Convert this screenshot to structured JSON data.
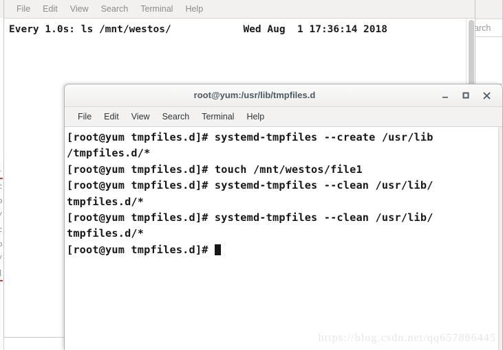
{
  "background_window": {
    "name": "watch-terminal",
    "menu": [
      "File",
      "Edit",
      "View",
      "Search",
      "Terminal",
      "Help"
    ],
    "watch_line": "Every 1.0s: ls /mnt/westos/            Wed Aug  1 17:36:14 2018"
  },
  "right_background_window": {
    "search_placeholder_fragment": "earch"
  },
  "terminal": {
    "title": "root@yum:/usr/lib/tmpfiles.d",
    "menu": [
      "File",
      "Edit",
      "View",
      "Search",
      "Terminal",
      "Help"
    ],
    "controls": {
      "minimize": "minimize-icon",
      "maximize": "maximize-icon",
      "close": "close-icon"
    },
    "lines": [
      "[root@yum tmpfiles.d]# systemd-tmpfiles --create /usr/lib",
      "/tmpfiles.d/*",
      "[root@yum tmpfiles.d]# touch /mnt/westos/file1",
      "[root@yum tmpfiles.d]# systemd-tmpfiles --clean /usr/lib/",
      "tmpfiles.d/*",
      "[root@yum tmpfiles.d]# systemd-tmpfiles --clean /usr/lib/",
      "tmpfiles.d/*",
      "[root@yum tmpfiles.d]# "
    ],
    "prompt_last": "[root@yum tmpfiles.d]# "
  },
  "watermark": {
    "text": "https://blog.csdn.net/qq657886445"
  },
  "colors": {
    "titlebar_text": "#4a5a66",
    "menubar_bg": "#f3f2f1",
    "terminal_bg": "#ffffff",
    "terminal_text": "#171717",
    "watermark": "#e6e6e6"
  }
}
